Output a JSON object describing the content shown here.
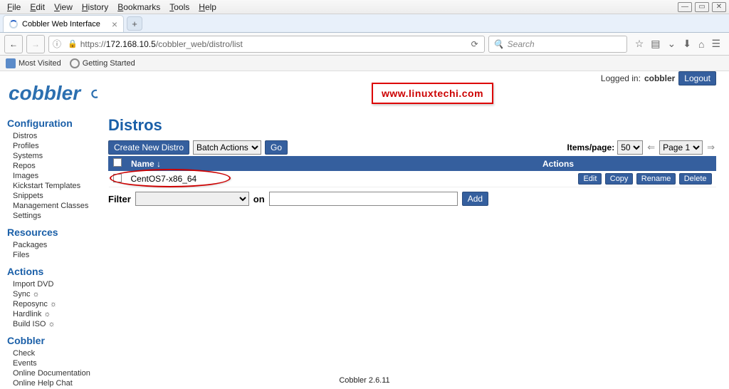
{
  "browser": {
    "menu": [
      "File",
      "Edit",
      "View",
      "History",
      "Bookmarks",
      "Tools",
      "Help"
    ],
    "tab_title": "Cobbler Web Interface",
    "url_host": "172.168.10.5",
    "url_path": "/cobbler_web/distro/list",
    "url_scheme": "https://",
    "search_placeholder": "Search",
    "bookmarks": {
      "most_visited": "Most Visited",
      "getting_started": "Getting Started"
    }
  },
  "loginbar": {
    "prefix": "Logged in: ",
    "user": "cobbler",
    "logout": "Logout"
  },
  "watermark": "www.linuxtechi.com",
  "sidebar": {
    "groups": [
      {
        "head": "Configuration",
        "items": [
          "Distros",
          "Profiles",
          "Systems",
          "Repos",
          "Images",
          "Kickstart Templates",
          "Snippets",
          "Management Classes",
          "Settings"
        ]
      },
      {
        "head": "Resources",
        "items": [
          "Packages",
          "Files"
        ]
      },
      {
        "head": "Actions",
        "items": [
          "Import DVD",
          "Sync ☼",
          "Reposync ☼",
          "Hardlink ☼",
          "Build ISO ☼"
        ]
      },
      {
        "head": "Cobbler",
        "items": [
          "Check",
          "Events",
          "Online Documentation",
          "Online Help Chat"
        ]
      }
    ]
  },
  "page": {
    "title": "Distros",
    "create_btn": "Create New Distro",
    "batch_label": "Batch Actions",
    "go": "Go",
    "items_per_page_label": "Items/page:",
    "items_per_page_value": "50",
    "page_label": "Page 1",
    "headers": {
      "name": "Name ↓",
      "actions": "Actions"
    },
    "rows": [
      {
        "name": "CentOS7-x86_64"
      }
    ],
    "row_actions": [
      "Edit",
      "Copy",
      "Rename",
      "Delete"
    ],
    "filter_label": "Filter",
    "filter_on": "on",
    "add": "Add"
  },
  "footer": "Cobbler 2.6.11"
}
